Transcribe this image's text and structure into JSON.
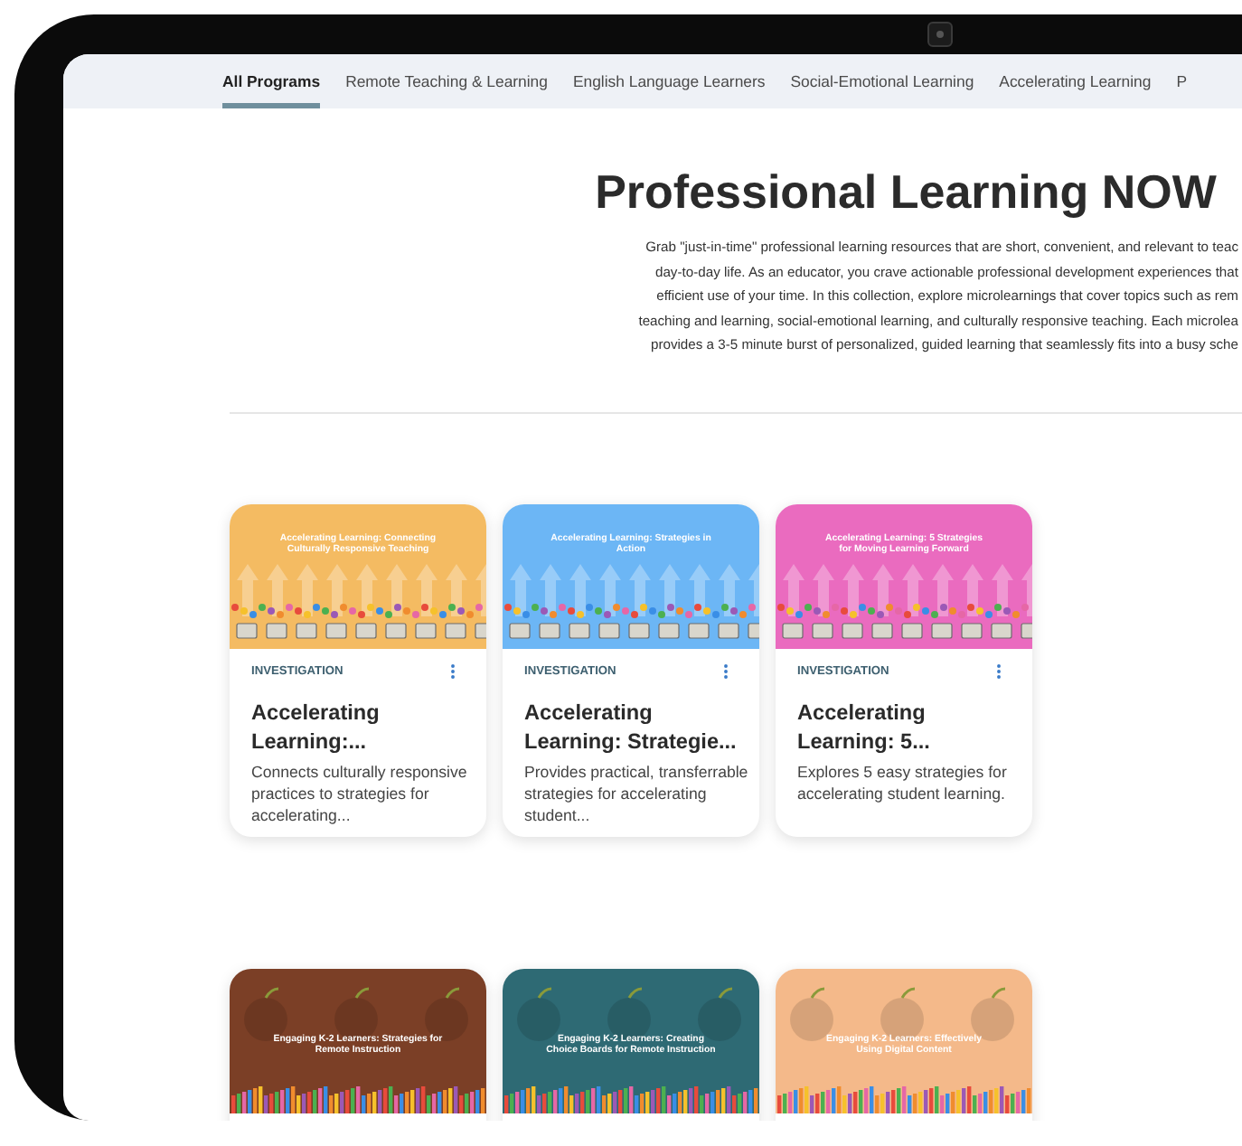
{
  "nav": {
    "tabs": [
      {
        "label": "All Programs",
        "selected": true
      },
      {
        "label": "Remote Teaching & Learning",
        "selected": false
      },
      {
        "label": "English Language Learners",
        "selected": false
      },
      {
        "label": "Social-Emotional Learning",
        "selected": false
      },
      {
        "label": "Accelerating Learning",
        "selected": false
      },
      {
        "label": "P",
        "selected": false
      }
    ]
  },
  "header": {
    "title": "Professional Learning NOW",
    "intro_lines": [
      "Grab \"just-in-time\" professional learning resources that are short, convenient, and relevant to teac",
      "day-to-day life. As an educator, you crave actionable professional development experiences that",
      "efficient use of your time. In this collection, explore microlearnings that cover topics such as rem",
      "teaching and learning, social-emotional learning, and culturally responsive teaching. Each microlea",
      "provides a 3-5 minute burst of personalized, guided learning that seamlessly fits into a busy sche"
    ]
  },
  "cards": [
    {
      "kind": "arrows",
      "color": "#f4bb62",
      "image_title": "Accelerating Learning: Connecting Culturally Responsive Teaching",
      "tag": "INVESTIGATION",
      "title": "Accelerating Learning:...",
      "description": "Connects culturally responsive practices to strategies for accelerating..."
    },
    {
      "kind": "arrows",
      "color": "#6cb6f5",
      "image_title": "Accelerating Learning: Strategies in Action",
      "tag": "INVESTIGATION",
      "title": "Accelerating Learning: Strategie...",
      "description": "Provides practical, transferrable strategies for accelerating student..."
    },
    {
      "kind": "arrows",
      "color": "#ea6bbf",
      "image_title": "Accelerating Learning: 5 Strategies for Moving Learning Forward",
      "tag": "INVESTIGATION",
      "title": "Accelerating Learning: 5...",
      "description": "Explores 5 easy strategies for accelerating student learning."
    },
    {
      "kind": "apples",
      "color": "#7b3f26",
      "image_title": "Engaging K-2 Learners: Strategies for Remote Instruction"
    },
    {
      "kind": "apples",
      "color": "#2e6a74",
      "image_title": "Engaging K-2 Learners: Creating Choice Boards for Remote Instruction"
    },
    {
      "kind": "apples",
      "color": "#f4b98a",
      "image_title": "Engaging K-2 Learners: Effectively Using Digital Content"
    }
  ]
}
